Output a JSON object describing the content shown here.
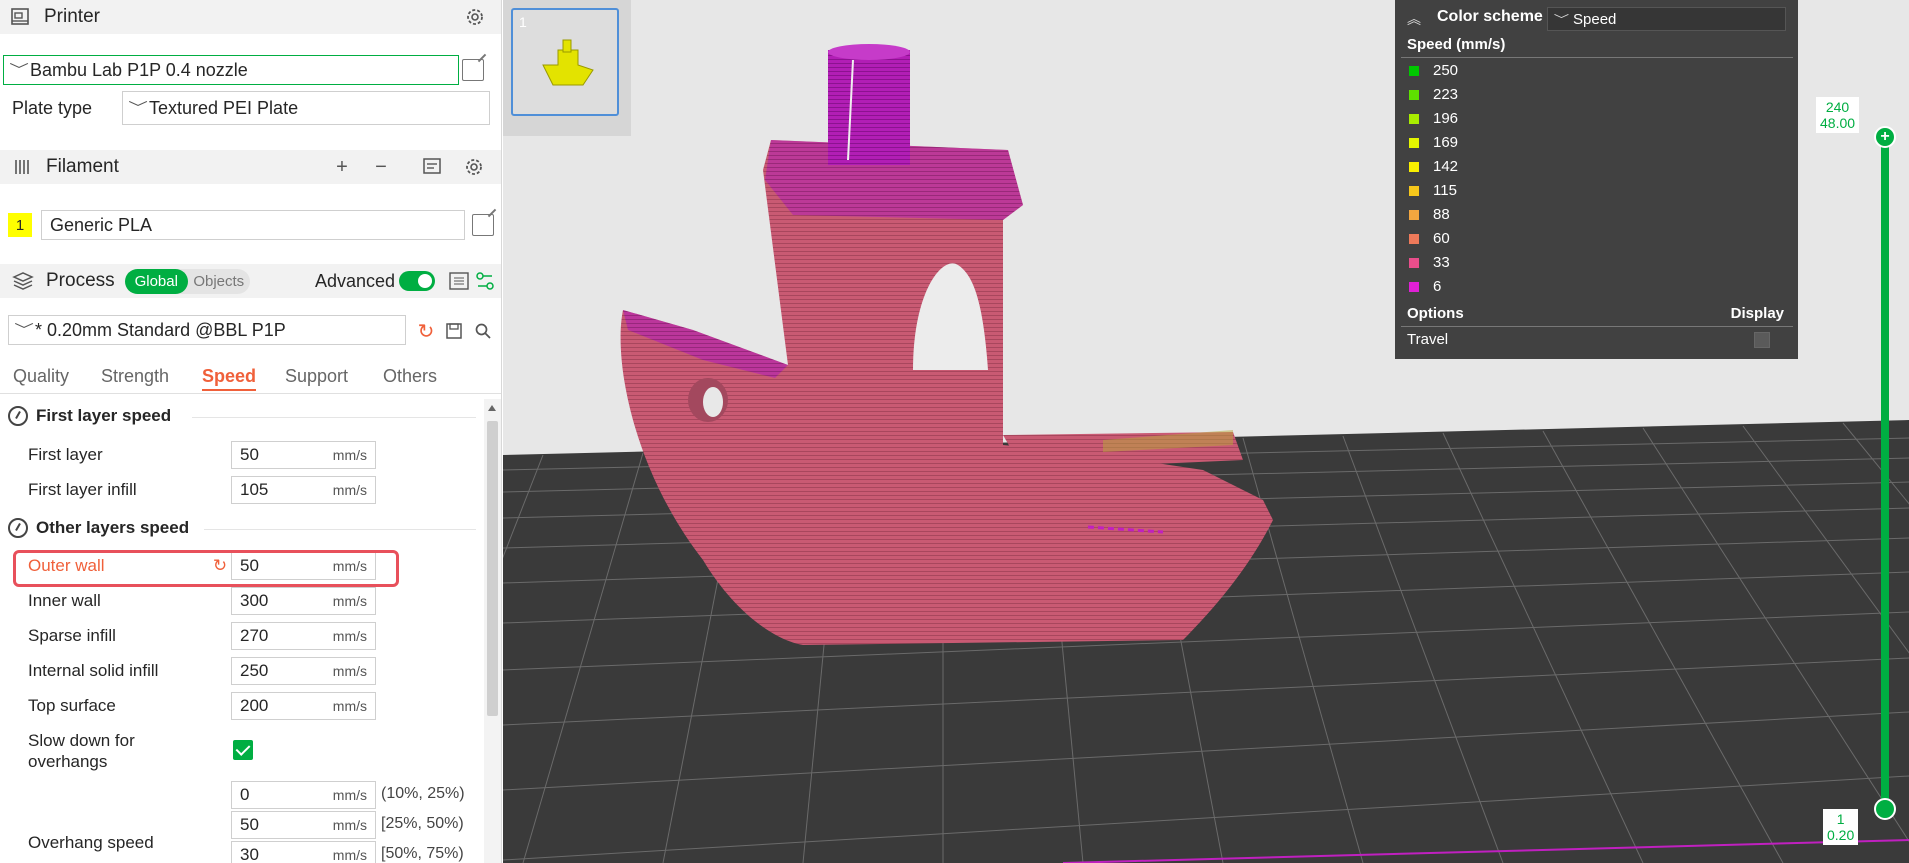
{
  "printer": {
    "title": "Printer",
    "selected": "Bambu Lab P1P 0.4 nozzle",
    "plate_type_label": "Plate type",
    "plate_type_value": "Textured PEI Plate"
  },
  "filament": {
    "title": "Filament",
    "slot_number": "1",
    "slot_color": "#ffff00",
    "name": "Generic PLA"
  },
  "process": {
    "title": "Process",
    "toggle_global": "Global",
    "toggle_objects": "Objects",
    "advanced_label": "Advanced",
    "advanced_on": true,
    "preset": "* 0.20mm Standard @BBL P1P"
  },
  "tabs": [
    "Quality",
    "Strength",
    "Speed",
    "Support",
    "Others"
  ],
  "active_tab": "Speed",
  "groups": {
    "first_layer_speed": "First layer speed",
    "other_layers_speed": "Other layers speed"
  },
  "fields": {
    "first_layer": {
      "label": "First layer",
      "value": "50",
      "unit": "mm/s"
    },
    "first_layer_infill": {
      "label": "First layer infill",
      "value": "105",
      "unit": "mm/s"
    },
    "outer_wall": {
      "label": "Outer wall",
      "value": "50",
      "unit": "mm/s"
    },
    "inner_wall": {
      "label": "Inner wall",
      "value": "300",
      "unit": "mm/s"
    },
    "sparse_infill": {
      "label": "Sparse infill",
      "value": "270",
      "unit": "mm/s"
    },
    "internal_solid_infill": {
      "label": "Internal solid infill",
      "value": "250",
      "unit": "mm/s"
    },
    "top_surface": {
      "label": "Top surface",
      "value": "200",
      "unit": "mm/s"
    },
    "slow_down_overhangs": {
      "label_line1": "Slow down for",
      "label_line2": "overhangs",
      "checked": true
    },
    "overhang_speed": {
      "label": "Overhang speed",
      "rows": [
        {
          "value": "0",
          "unit": "mm/s",
          "range": "(10%, 25%)"
        },
        {
          "value": "50",
          "unit": "mm/s",
          "range": "[25%, 50%)"
        },
        {
          "value": "30",
          "unit": "mm/s",
          "range": "[50%, 75%)"
        }
      ]
    }
  },
  "plate_thumb_number": "1",
  "legend": {
    "color_scheme_label": "Color scheme",
    "color_scheme_value": "Speed",
    "title": "Speed (mm/s)",
    "items": [
      {
        "value": "250",
        "color": "#00c800"
      },
      {
        "value": "223",
        "color": "#5ee000"
      },
      {
        "value": "196",
        "color": "#a8ec00"
      },
      {
        "value": "169",
        "color": "#e4f500"
      },
      {
        "value": "142",
        "color": "#f9ef00"
      },
      {
        "value": "115",
        "color": "#f6c71b"
      },
      {
        "value": "88",
        "color": "#f2a63f"
      },
      {
        "value": "60",
        "color": "#ee7a5a"
      },
      {
        "value": "33",
        "color": "#e94e8b"
      },
      {
        "value": "6",
        "color": "#e020d6"
      }
    ],
    "options_label": "Options",
    "display_label": "Display",
    "travel_label": "Travel"
  },
  "layer_slider": {
    "top_layer": "240",
    "top_height": "48.00",
    "bottom_layer": "1",
    "bottom_height": "0.20"
  },
  "colors": {
    "accent": "#00ae42",
    "highlight": "#f0603a",
    "model": "#c95a73",
    "model_top": "#b21eb5"
  }
}
